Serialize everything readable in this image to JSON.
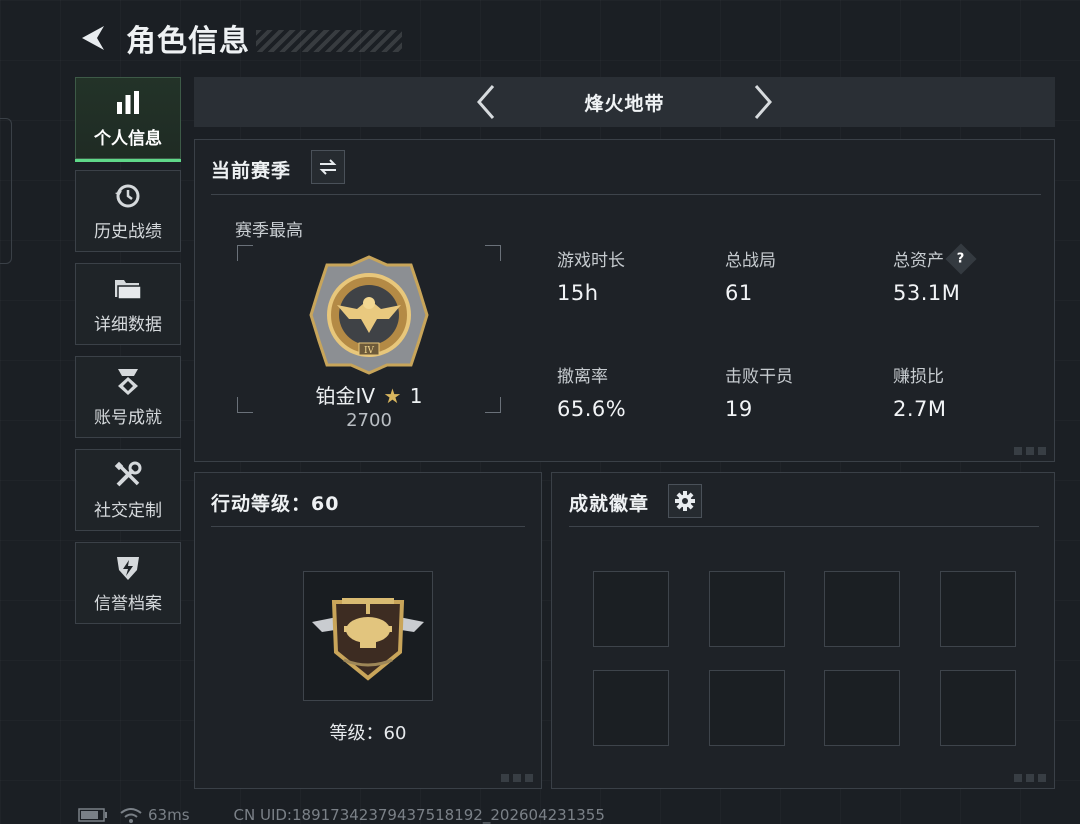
{
  "header": {
    "title": "角色信息",
    "back_icon": "back-arrow-icon"
  },
  "sidebar": {
    "items": [
      {
        "label": "个人信息",
        "icon": "bar-chart-icon",
        "active": true
      },
      {
        "label": "历史战绩",
        "icon": "history-clock-icon",
        "active": false
      },
      {
        "label": "详细数据",
        "icon": "folder-icon",
        "active": false
      },
      {
        "label": "账号成就",
        "icon": "achievement-medal-icon",
        "active": false
      },
      {
        "label": "社交定制",
        "icon": "tools-icon",
        "active": false
      },
      {
        "label": "信誉档案",
        "icon": "shield-lightning-icon",
        "active": false
      }
    ]
  },
  "mode_selector": {
    "name": "烽火地带"
  },
  "season": {
    "title": "当前赛季",
    "switch_icon": "swap-icon",
    "best_label": "赛季最高",
    "rank_name": "铂金IV",
    "rank_stars": "1",
    "rank_score": "2700",
    "stats": [
      {
        "label": "游戏时长",
        "value": "15h"
      },
      {
        "label": "总战局",
        "value": "61"
      },
      {
        "label": "总资产",
        "value": "53.1M",
        "help": "?"
      },
      {
        "label": "撤离率",
        "value": "65.6%"
      },
      {
        "label": "击败干员",
        "value": "19"
      },
      {
        "label": "赚损比",
        "value": "2.7M"
      }
    ]
  },
  "action_level": {
    "title": "行动等级：60",
    "level_text": "等级：60"
  },
  "achievements": {
    "title": "成就徽章",
    "settings_icon": "gear-icon",
    "slots": 8
  },
  "statusbar": {
    "ping": "63ms",
    "uid": "CN UID:18917342379437518192_202604231355"
  },
  "colors": {
    "accent": "#5fd889",
    "gold": "#c9a55a",
    "background": "#1b1f24",
    "panel": "#1e2227"
  }
}
